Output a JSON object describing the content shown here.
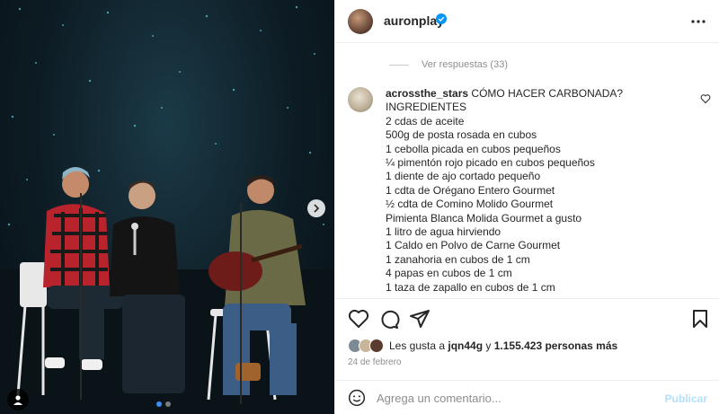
{
  "post": {
    "username": "auronplay",
    "verified_icon": "verified-badge-icon",
    "more_icon": "more-options-icon"
  },
  "comments_section": {
    "view_replies": "Ver respuestas (33)",
    "comment": {
      "username": "acrossthe_stars",
      "lines": [
        "CÓMO HACER CARBONADA?",
        "INGREDIENTES",
        "2 cdas de aceite",
        "500g de posta rosada en cubos",
        "1 cebolla picada en cubos pequeños",
        "¼ pimentón rojo picado en cubos pequeños",
        "1 diente de ajo cortado pequeño",
        "1 cdta de Orégano Entero Gourmet",
        "½ cdta de Comino Molido Gourmet",
        "Pimienta Blanca Molida Gourmet a gusto",
        "1 litro de agua hirviendo",
        "1 Caldo en Polvo de Carne Gourmet",
        "1 zanahoria en cubos de 1 cm",
        "4 papas en cubos de 1 cm",
        "1 taza de zapallo en cubos de 1 cm"
      ]
    }
  },
  "likes": {
    "prefix": "Les gusta a",
    "user": "jqn44g",
    "middle": "y",
    "count": "1.155.423 personas más"
  },
  "date": "24 de febrero",
  "add_comment": {
    "placeholder": "Agrega un comentario...",
    "publish_label": "Publicar"
  },
  "carousel": {
    "current_index": 1,
    "total": 2
  },
  "colors": {
    "accent": "#0095f6",
    "publish_disabled": "#b2dffc",
    "muted": "#8e8e8e"
  }
}
